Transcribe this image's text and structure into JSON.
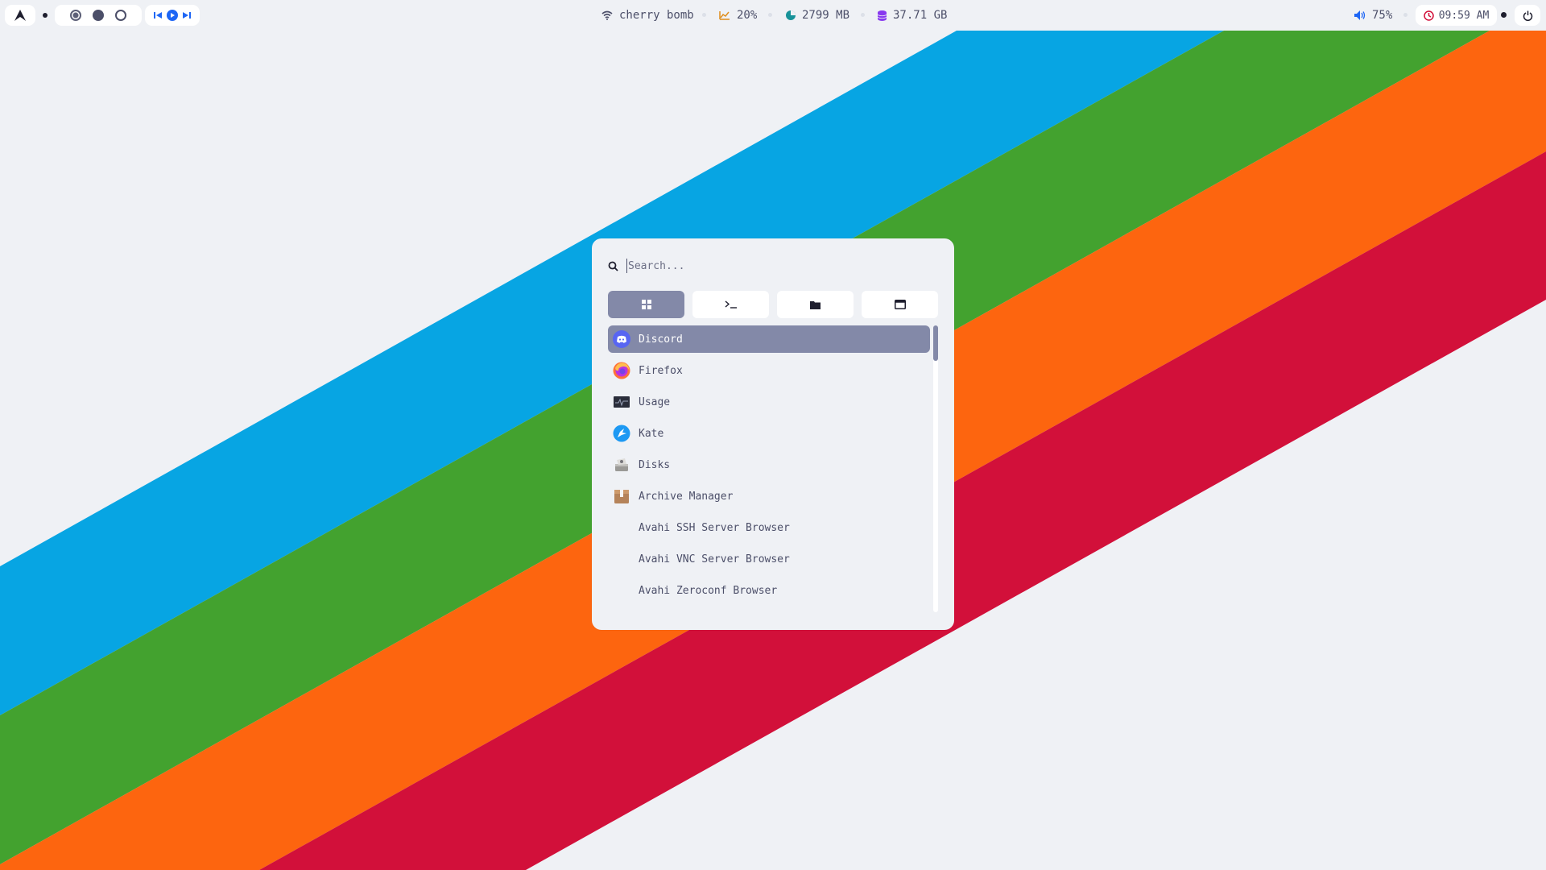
{
  "topbar": {
    "logo_icon": "arch-logo-icon",
    "workspaces": [
      "workspace-1",
      "workspace-2",
      "workspace-3"
    ],
    "media": [
      "previous-icon",
      "play-icon",
      "next-icon"
    ],
    "wifi": "cherry bomb",
    "cpu": "20%",
    "memory": "2799 MB",
    "disk": "37.71 GB",
    "volume": "75%",
    "clock": "09:59 AM"
  },
  "launcher": {
    "search_placeholder": "Search...",
    "modes": [
      "apps-grid-icon",
      "terminal-icon",
      "folder-icon",
      "window-icon"
    ],
    "items": [
      {
        "label": "Discord",
        "icon": "discord-icon",
        "selected": true
      },
      {
        "label": "Firefox",
        "icon": "firefox-icon"
      },
      {
        "label": "Usage",
        "icon": "usage-monitor-icon"
      },
      {
        "label": "Kate",
        "icon": "kate-icon"
      },
      {
        "label": "Disks",
        "icon": "disks-icon"
      },
      {
        "label": "Archive Manager",
        "icon": "archive-manager-icon"
      },
      {
        "label": "Avahi SSH Server Browser",
        "icon": ""
      },
      {
        "label": "Avahi VNC Server Browser",
        "icon": ""
      },
      {
        "label": "Avahi Zeroconf Browser",
        "icon": ""
      }
    ]
  },
  "colors": {
    "background": "#eff1f5",
    "stripe_blue": "#07a5e3",
    "stripe_green": "#43a22f",
    "stripe_orange": "#fd650f",
    "stripe_red": "#d2103a",
    "accent": "#8389a8"
  }
}
